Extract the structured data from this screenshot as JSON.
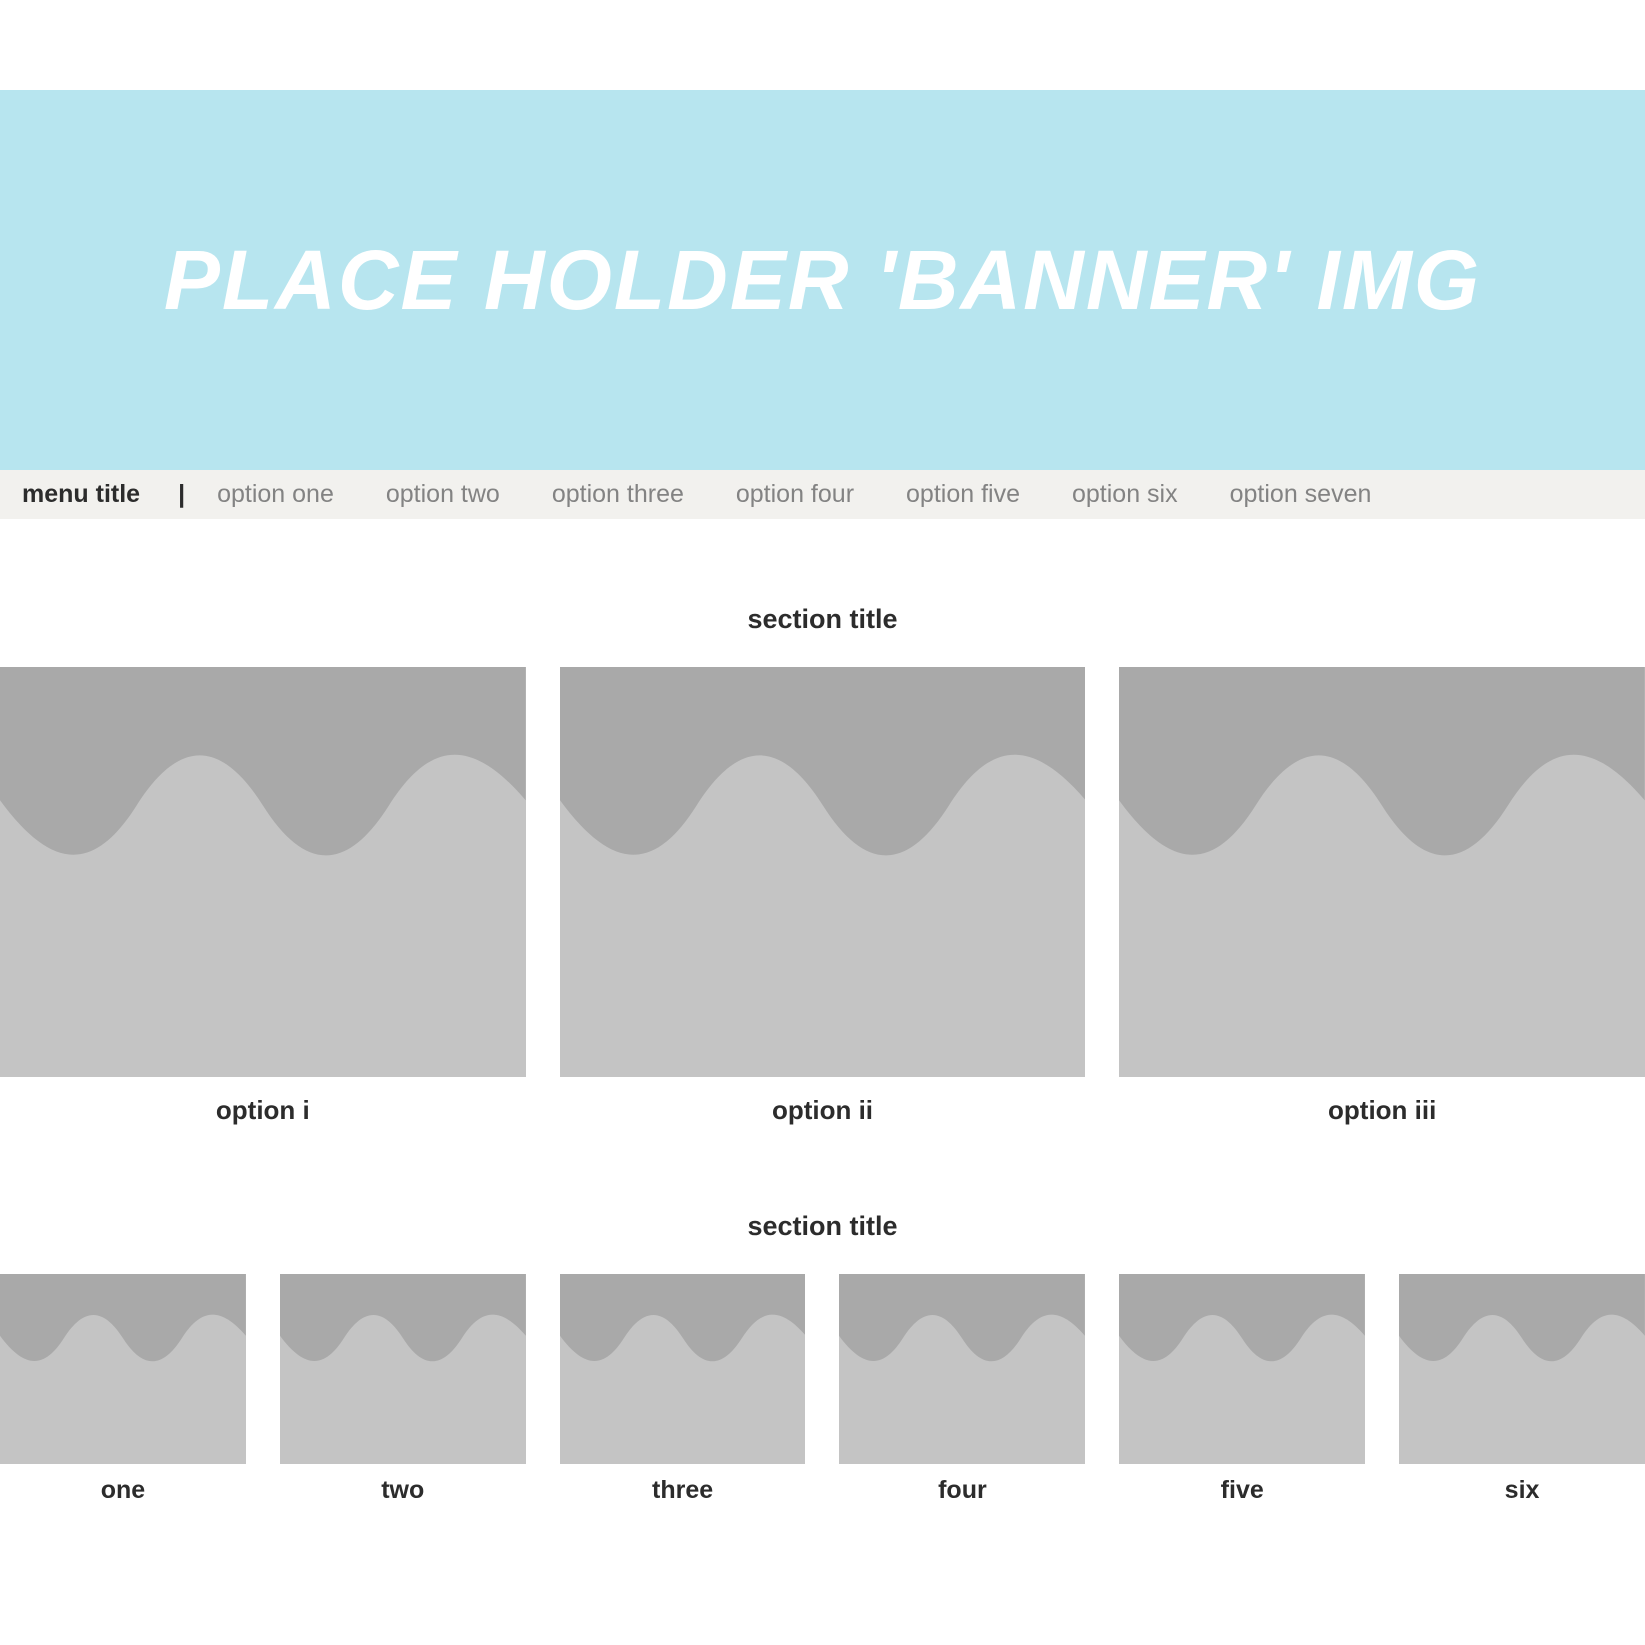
{
  "banner": {
    "text": "Place holder 'banner' img"
  },
  "menu": {
    "title": "menu title",
    "separator": "|",
    "options": [
      "option one",
      "option two",
      "option three",
      "option four",
      "option five",
      "option six",
      "option seven"
    ]
  },
  "section_large": {
    "title": "section title",
    "items": [
      {
        "label": "option i"
      },
      {
        "label": "option ii"
      },
      {
        "label": "option iii"
      }
    ]
  },
  "section_small": {
    "title": "section title",
    "items": [
      {
        "label": "one"
      },
      {
        "label": "two"
      },
      {
        "label": "three"
      },
      {
        "label": "four"
      },
      {
        "label": "five"
      },
      {
        "label": "six"
      }
    ]
  },
  "colors": {
    "banner_bg": "#b7e5ef",
    "banner_text": "#ffffff",
    "menu_bg": "#f2f1ee",
    "menu_option": "#838383",
    "thumb_bg": "#c4c4c4",
    "thumb_wave": "#a9a9a9",
    "text_dark": "#2c2c2c"
  }
}
